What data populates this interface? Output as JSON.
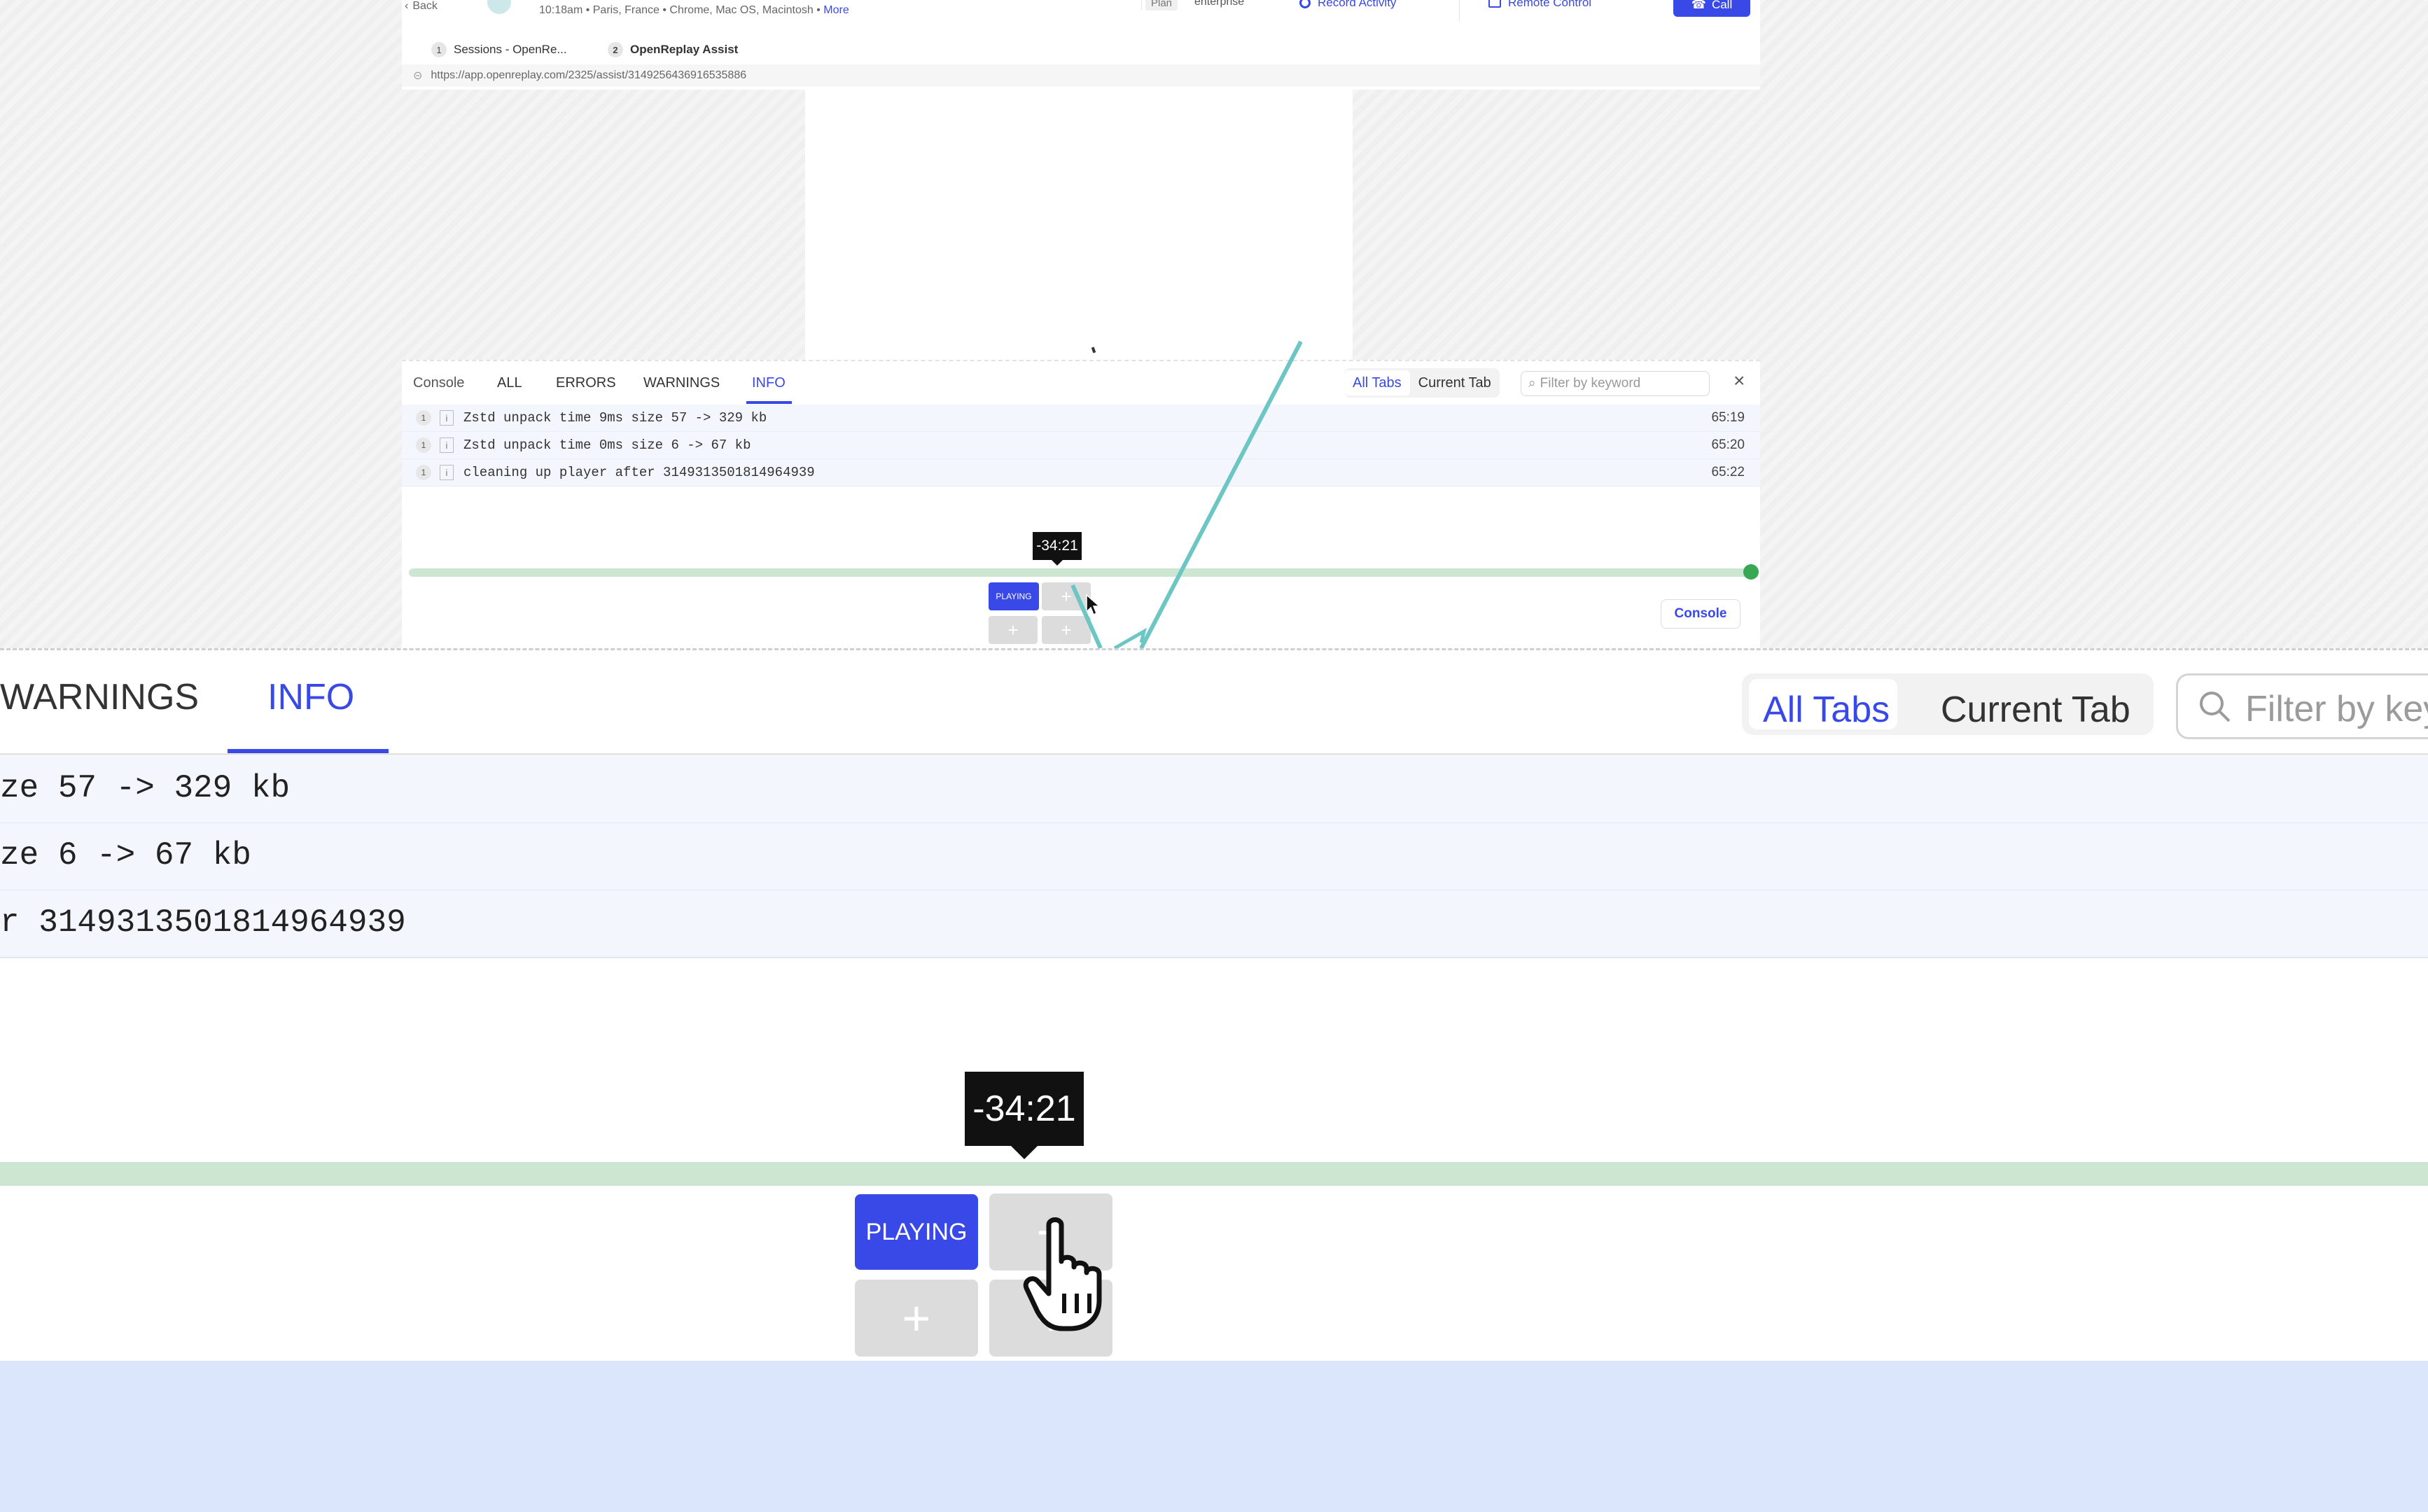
{
  "header": {
    "back_label": "Back",
    "session_meta": "10:18am • Paris, France • Chrome, Mac OS, Macintosh •",
    "more_link": "More",
    "plan_label": "Plan",
    "plan_value": "enterprise",
    "record_activity": "Record Activity",
    "remote_control": "Remote Control",
    "call": "Call"
  },
  "browser_tabs": [
    {
      "num": "1",
      "label": "Sessions - OpenRe..."
    },
    {
      "num": "2",
      "label": "OpenReplay Assist"
    }
  ],
  "url": "https://app.openreplay.com/2325/assist/3149256436916535886",
  "console": {
    "title": "Console",
    "tabs": [
      "ALL",
      "ERRORS",
      "WARNINGS",
      "INFO"
    ],
    "active_tab": "INFO",
    "scope_tabs": [
      "All Tabs",
      "Current Tab"
    ],
    "active_scope": "All Tabs",
    "filter_placeholder": "Filter by keyword",
    "filter_placeholder_zoom": "Filter by key",
    "rows": [
      {
        "count": "1",
        "icon": "i",
        "message": "Zstd unpack time 9ms size 57 -> 329 kb",
        "time": "65:19",
        "zoom_text": "ze 57 -> 329 kb"
      },
      {
        "count": "1",
        "icon": "i",
        "message": "Zstd unpack time 0ms size 6 -> 67 kb",
        "time": "65:20",
        "zoom_text": "ze 6 -> 67 kb"
      },
      {
        "count": "1",
        "icon": "i",
        "message": "cleaning up player after 3149313501814964939",
        "time": "65:22",
        "zoom_text": "r 3149313501814964939"
      }
    ]
  },
  "player": {
    "tooltip_time": "-34:21",
    "playing_label": "PLAYING",
    "plus": "+",
    "console_button": "Console"
  },
  "colors": {
    "accent": "#3949e8",
    "timeline": "#cde6d2",
    "timeline_dot": "#39a852",
    "row_bg": "#f3f6fd",
    "bottom_band": "#dbe6fd",
    "annotation_line": "#6cc6c4"
  }
}
